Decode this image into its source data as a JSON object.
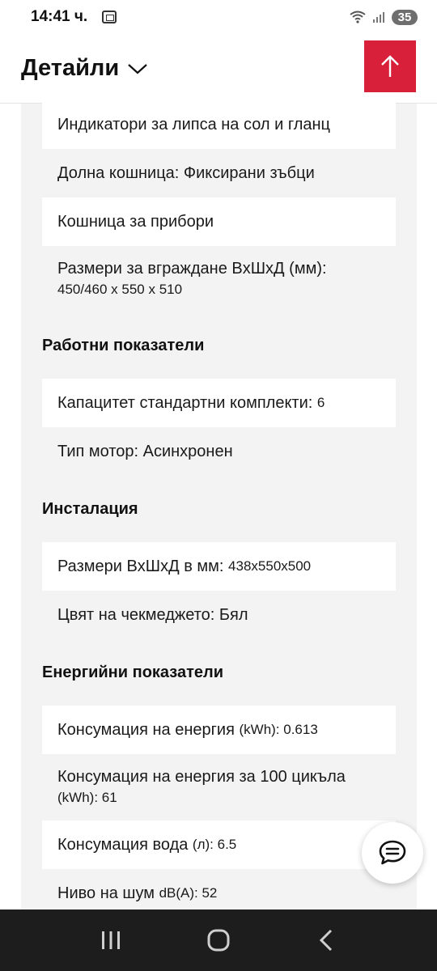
{
  "status_bar": {
    "time": "14:41 ч.",
    "battery": "35"
  },
  "header": {
    "title": "Детайли"
  },
  "rows_top": [
    {
      "label": "Индикатори за липса на сол и гланц",
      "value": ""
    },
    {
      "label": "Долна кошница: Фиксирани зъбци",
      "value": ""
    },
    {
      "label": "Кошница за прибори",
      "value": ""
    }
  ],
  "row_dimensions": {
    "line1": "Размери за вграждане ВxШxД (мм):",
    "line2": "450/460 x 550 x 510"
  },
  "sections": [
    {
      "title": "Работни показатели",
      "rows": [
        {
          "label": "Капацитет стандартни комплекти:",
          "value": "6"
        },
        {
          "label": "Тип мотор: Асинхронен",
          "value": ""
        }
      ]
    },
    {
      "title": "Инсталация",
      "rows": [
        {
          "label": "Размери ВxШxД в мм:",
          "value": "438x550x500"
        },
        {
          "label": "Цвят на чекмеджето: Бял",
          "value": ""
        }
      ]
    },
    {
      "title": "Енергийни показатели",
      "rows": [
        {
          "label": "Консумация на енергия",
          "value": "(kWh): 0.613"
        }
      ]
    }
  ],
  "energy_100": {
    "line1": "Консумация на енергия за 100 цикъла",
    "line2": "(kWh): 61"
  },
  "rows_bottom": [
    {
      "label": "Консумация вода",
      "value": "(л): 6.5"
    },
    {
      "label": "Ниво на шум",
      "value": "dB(A): 52"
    }
  ],
  "icons": {
    "scroll_top": "arrow-up-icon",
    "chat": "chat-bubble-icon",
    "nav_recent": "recent-apps-icon",
    "nav_home": "home-icon",
    "nav_back": "back-icon"
  },
  "colors": {
    "accent": "#d9203a",
    "panel_bg": "#f3f3f3",
    "nav_bg": "#1d1d1d"
  }
}
